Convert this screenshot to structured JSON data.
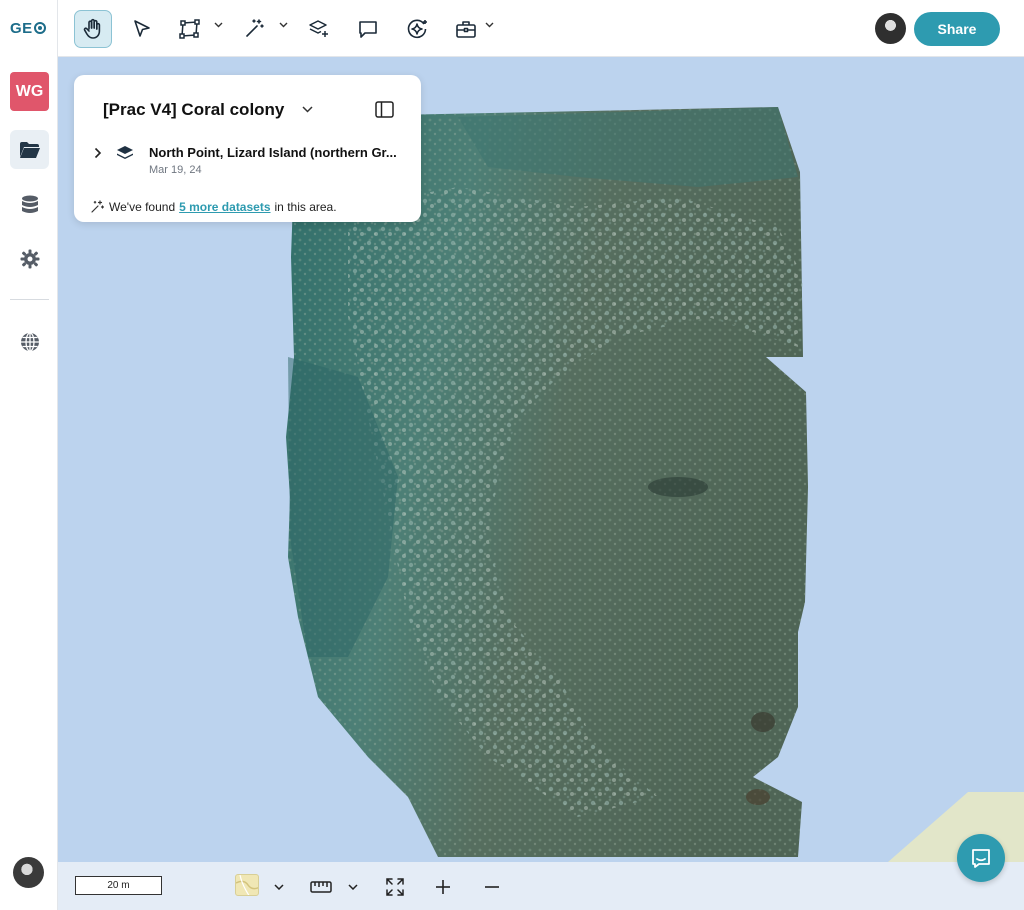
{
  "sidebar": {
    "logo_text": "GE",
    "workspace_badge": "WG",
    "items": [
      {
        "name": "folder-icon"
      },
      {
        "name": "database-icon"
      },
      {
        "name": "gear-icon"
      },
      {
        "name": "globe-icon"
      }
    ]
  },
  "toolbar": {
    "tools": [
      "hand-icon",
      "pointer-icon",
      "polygon-icon",
      "magic-wand-icon",
      "layers-add-icon",
      "comment-icon",
      "ai-sparkle-icon",
      "toolbox-icon"
    ],
    "share_label": "Share"
  },
  "panel": {
    "title": "[Prac V4] Coral colony",
    "dataset": {
      "name": "North Point, Lizard Island (northern Gr...",
      "date": "Mar 19, 24"
    },
    "found_prefix": "We've found",
    "found_link": "5 more datasets",
    "found_suffix": "in this area."
  },
  "bottom": {
    "scale_label": "20 m"
  },
  "colors": {
    "accent": "#2e9bb0",
    "badge": "#e0566b",
    "map_bg": "#bcd3ee"
  }
}
